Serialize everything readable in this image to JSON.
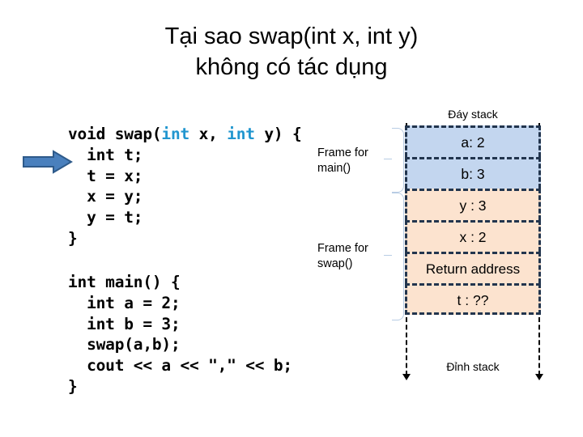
{
  "slide": {
    "title_lines": [
      "Tại sao swap(int x, int y)",
      "không có tác dụng"
    ]
  },
  "code": {
    "swap_function": {
      "lines": [
        "void swap(int x, int y) {",
        "  int t;",
        "  t = x;",
        "  x = y;",
        "  y = t;",
        "}"
      ],
      "keyword_color": "#2196cf",
      "text_color": "#000000"
    },
    "main_function": {
      "lines": [
        "int main() {",
        "  int a = 2;",
        "  int b = 3;",
        "  swap(a,b);",
        "  cout << a << \",\" << b;",
        "}"
      ],
      "text_color": "#000000"
    }
  },
  "execution_pointer": {
    "icon": "right-arrow-icon",
    "points_at_line": "  int t;",
    "fill_color": "#4a80bd",
    "stroke_color": "#2e5a8a"
  },
  "stack": {
    "top_label": "Đáy stack",
    "bottom_label": "Đỉnh stack",
    "blue_color": "#c3d6ef",
    "peach_color": "#fce3cf",
    "border_color": "#22354e",
    "rows": [
      {
        "text": "a: 2",
        "color": "blue"
      },
      {
        "text": "b: 3",
        "color": "blue"
      },
      {
        "text": "y : 3",
        "color": "peach"
      },
      {
        "text": "x : 2",
        "color": "peach"
      },
      {
        "text": "Return address",
        "color": "peach"
      },
      {
        "text": "t : ??",
        "color": "peach"
      }
    ]
  },
  "frames": [
    {
      "label_line1": "Frame for",
      "label_line2": "main()",
      "spans_rows": [
        "a: 2",
        "b: 3"
      ]
    },
    {
      "label_line1": "Frame for",
      "label_line2": "swap()",
      "spans_rows": [
        "y : 3",
        "x : 2",
        "Return address",
        "t : ??"
      ]
    }
  ]
}
